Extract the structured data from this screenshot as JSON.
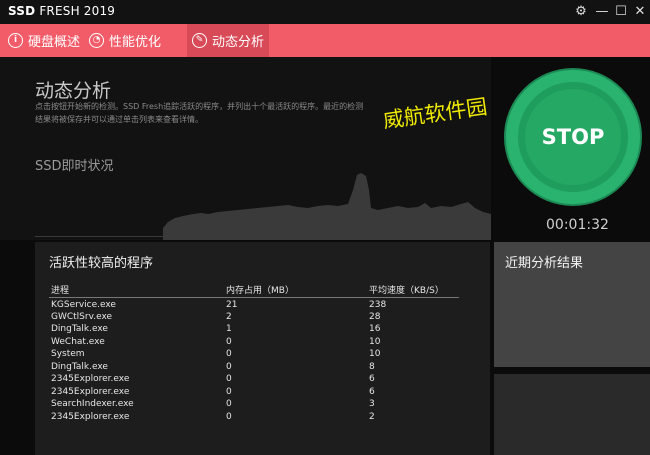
{
  "app": {
    "title_bold": "SSD",
    "title_rest": " FRESH 2019"
  },
  "window_controls": {
    "settings": "⚙",
    "minimize": "—",
    "restore": "☐",
    "close": "✕"
  },
  "tabs": [
    {
      "label": "硬盘概述",
      "icon": "i"
    },
    {
      "label": "性能优化",
      "icon": "◔"
    },
    {
      "label": "动态分析",
      "icon": "✎"
    }
  ],
  "analysis": {
    "title": "动态分析",
    "description": "点击按钮开始新的检测。SSD Fresh追踪活跃的程序，并列出十个最活跃的程序。最近的检测结果将被保存并可以通过单击列表来查看详情。",
    "watermark": "威航软件园",
    "ssd_label": "SSD即时状况"
  },
  "stop_button": {
    "label": "STOP"
  },
  "timer": "00:01:32",
  "processes": {
    "title": "活跃性较高的程序",
    "columns": [
      "进程",
      "内存占用（MB）",
      "平均速度（KB/S）"
    ],
    "rows": [
      [
        "KGService.exe",
        "21",
        "238"
      ],
      [
        "GWCtlSrv.exe",
        "2",
        "28"
      ],
      [
        "DingTalk.exe",
        "1",
        "16"
      ],
      [
        "WeChat.exe",
        "0",
        "10"
      ],
      [
        "System",
        "0",
        "10"
      ],
      [
        "DingTalk.exe",
        "0",
        "8"
      ],
      [
        "2345Explorer.exe",
        "0",
        "6"
      ],
      [
        "2345Explorer.exe",
        "0",
        "6"
      ],
      [
        "SearchIndexer.exe",
        "0",
        "3"
      ],
      [
        "2345Explorer.exe",
        "0",
        "2"
      ]
    ]
  },
  "recent": {
    "title": "近期分析结果"
  },
  "colors": {
    "accent": "#f25c69",
    "tab_active": "#d84a57",
    "stop_green": "#25a863"
  }
}
